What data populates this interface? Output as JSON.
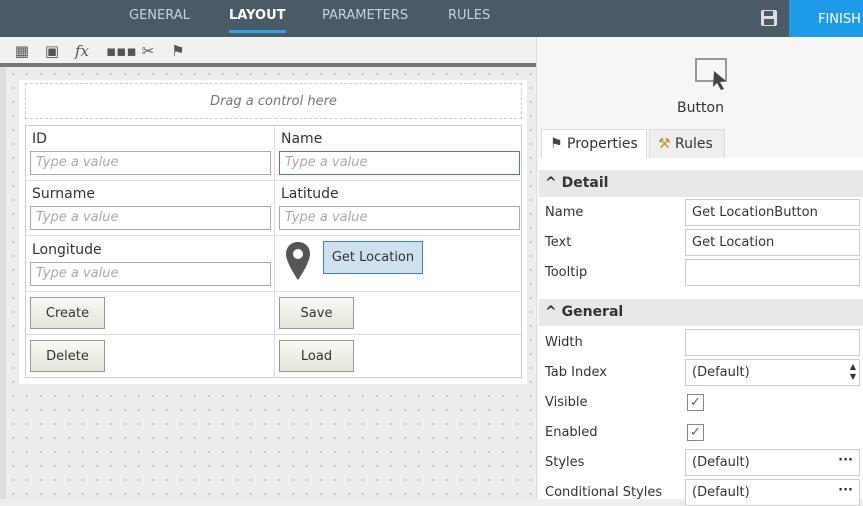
{
  "header": {
    "tabs": [
      "GENERAL",
      "LAYOUT",
      "PARAMETERS",
      "RULES"
    ],
    "active": "LAYOUT",
    "finish": "FINISH"
  },
  "canvas": {
    "drop_hint": "Drag a control here"
  },
  "form": {
    "fields": [
      {
        "label": "ID",
        "placeholder": "Type a value"
      },
      {
        "label": "Name",
        "placeholder": "Type a value"
      },
      {
        "label": "Surname",
        "placeholder": "Type a value"
      },
      {
        "label": "Latitude",
        "placeholder": "Type a value"
      },
      {
        "label": "Longitude",
        "placeholder": "Type a value"
      }
    ],
    "get_location": "Get Location",
    "buttons": [
      "Create",
      "Save",
      "Delete",
      "Load"
    ]
  },
  "panel": {
    "control_type": "Button",
    "tabs": [
      "Properties",
      "Rules"
    ],
    "detail": {
      "title": "Detail",
      "rows": [
        {
          "label": "Name",
          "value": "Get LocationButton"
        },
        {
          "label": "Text",
          "value": "Get Location"
        },
        {
          "label": "Tooltip",
          "value": ""
        }
      ]
    },
    "general": {
      "title": "General",
      "width_label": "Width",
      "tabindex_label": "Tab Index",
      "tabindex_value": "(Default)",
      "visible_label": "Visible",
      "visible": true,
      "enabled_label": "Enabled",
      "enabled": true,
      "styles_label": "Styles",
      "styles_value": "(Default)",
      "cond_label": "Conditional Styles",
      "cond_value": "(Default)"
    }
  },
  "colors": {
    "header": "#4a5b66",
    "accent": "#1e9be8"
  }
}
